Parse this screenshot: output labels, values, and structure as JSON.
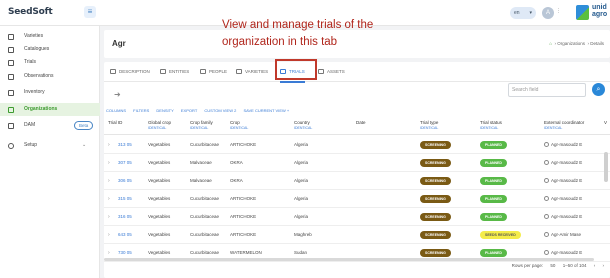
{
  "topbar": {
    "logo_text": "SeedSoft",
    "menu_icon": "hamburger-icon",
    "language": "en",
    "user_initial": "A",
    "brand_text_line1": "unid",
    "brand_text_line2": "agro"
  },
  "sidebar": {
    "items": [
      {
        "label": "Varieties",
        "icon": "seed-icon"
      },
      {
        "label": "Catalogues",
        "icon": "catalogue-icon"
      },
      {
        "label": "Trials",
        "icon": "trials-icon"
      },
      {
        "label": "Observations",
        "icon": "clipboard-icon"
      },
      {
        "label": "Inventory",
        "icon": "inventory-icon"
      },
      {
        "label": "Organizations",
        "icon": "organization-icon"
      },
      {
        "label": "DAM",
        "icon": "folder-icon",
        "badge": "Beta"
      },
      {
        "label": "Setup",
        "icon": "gear-icon"
      }
    ]
  },
  "header": {
    "title": "Agr",
    "breadcrumb": [
      "Organizations",
      "Details"
    ]
  },
  "tabs": [
    "DESCRIPTION",
    "ENTITIES",
    "PEOPLE",
    "VARIETIES",
    "TRIALS",
    "ASSETS"
  ],
  "callout": {
    "line1": "View and manage trials of the",
    "line2": "organization in this tab",
    "color": "#c0392b"
  },
  "search": {
    "placeholder": "Search field"
  },
  "grid_toolbar": [
    "COLUMNS",
    "FILTERS",
    "DENSITY",
    "EXPORT",
    "CUSTOM VIEW 2",
    "SAVE CURRENT VIEW +"
  ],
  "columns": [
    {
      "label": "Trial ID",
      "sub": ""
    },
    {
      "label": "Global crop",
      "sub": "IDENTICAL"
    },
    {
      "label": "Crop family",
      "sub": "IDENTICAL"
    },
    {
      "label": "Crop",
      "sub": "IDENTICAL"
    },
    {
      "label": "Country",
      "sub": "IDENTICAL"
    },
    {
      "label": "Date",
      "sub": ""
    },
    {
      "label": "Trial type",
      "sub": "IDENTICAL"
    },
    {
      "label": "Trial status",
      "sub": "IDENTICAL"
    },
    {
      "label": "External coordinator",
      "sub": "IDENTICAL"
    },
    {
      "label": "V",
      "sub": ""
    }
  ],
  "rows": [
    {
      "id": "313 05",
      "global_crop": "Vegetables",
      "family": "Cucurbitaceae",
      "crop": "ARTICHOKE",
      "country": "Algeria",
      "type": "SCREENING",
      "status": "PLANNED",
      "coordinator": "Agr-masoud2 E"
    },
    {
      "id": "307 05",
      "global_crop": "Vegetables",
      "family": "Malvaceae",
      "crop": "OKRA",
      "country": "Algeria",
      "type": "SCREENING",
      "status": "PLANNED",
      "coordinator": "Agr-masoud2 E"
    },
    {
      "id": "306 05",
      "global_crop": "Vegetables",
      "family": "Malvaceae",
      "crop": "OKRA",
      "country": "Algeria",
      "type": "SCREENING",
      "status": "PLANNED",
      "coordinator": "Agr-masoud2 E"
    },
    {
      "id": "315 05",
      "global_crop": "Vegetables",
      "family": "Cucurbitaceae",
      "crop": "ARTICHOKE",
      "country": "Algeria",
      "type": "SCREENING",
      "status": "PLANNED",
      "coordinator": "Agr-masoud2 E"
    },
    {
      "id": "316 05",
      "global_crop": "Vegetables",
      "family": "Cucurbitaceae",
      "crop": "ARTICHOKE",
      "country": "Algeria",
      "type": "SCREENING",
      "status": "PLANNED",
      "coordinator": "Agr-masoud2 E"
    },
    {
      "id": "643 05",
      "global_crop": "Vegetables",
      "family": "Cucurbitaceae",
      "crop": "ARTICHOKE",
      "country": "Maghreb",
      "type": "SCREENING",
      "status": "SEEDS RECEIVED",
      "coordinator": "Agr-Amir Mase"
    },
    {
      "id": "730 05",
      "global_crop": "Vegetables",
      "family": "Cucurbitaceae",
      "crop": "WATERMELON",
      "country": "Sudan",
      "type": "SCREENING",
      "status": "PLANNED",
      "coordinator": "Agr-masoud2 E"
    }
  ],
  "pager": {
    "rows_per_page_label": "Rows per page:",
    "rows_per_page": "50",
    "range": "1–50 of 104"
  }
}
